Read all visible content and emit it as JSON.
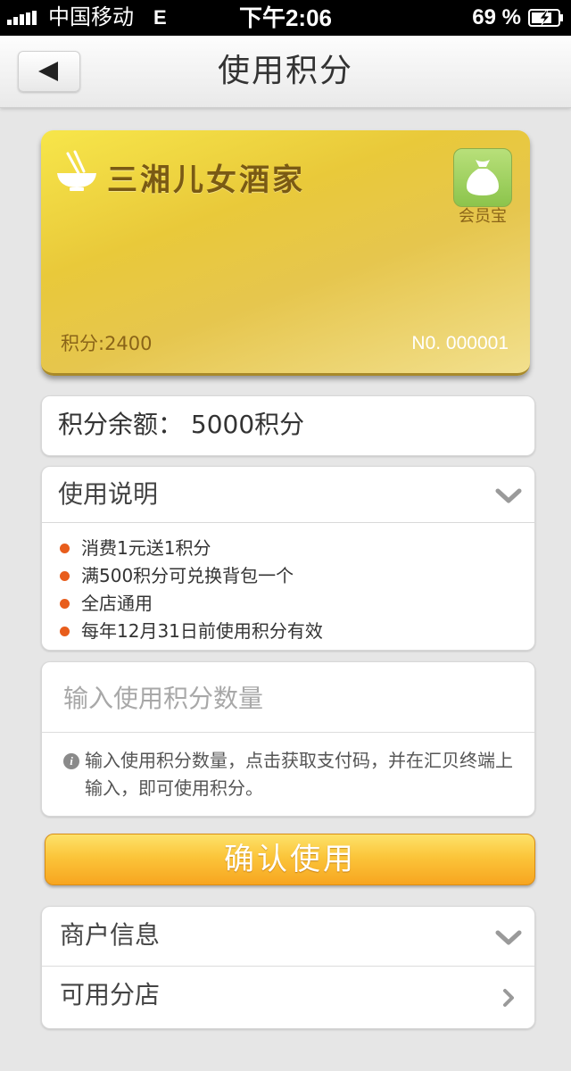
{
  "status_bar": {
    "carrier": "中国移动",
    "network": "E",
    "time": "下午2:06",
    "battery": "69 %",
    "icons": [
      "signal-icon",
      "battery-charging-icon"
    ]
  },
  "nav": {
    "title": "使用积分",
    "back_icon": "back-arrow-icon"
  },
  "card": {
    "store_name": "三湘儿女酒家",
    "brand_label": "会员宝",
    "points_label": "积分:2400",
    "card_no": "N0. 000001",
    "icons": [
      "rice-bowl-icon",
      "money-bag-icon"
    ],
    "colors": {
      "gold": "#e9c93a",
      "text": "#7a5a14"
    }
  },
  "balance": {
    "text": "积分余额： 5000积分"
  },
  "instructions": {
    "title": "使用说明",
    "items": [
      "消费1元送1积分",
      "满500积分可兑换背包一个",
      "全店通用",
      "每年12月31日前使用积分有效"
    ],
    "bullet_color": "#e85d1c"
  },
  "points_input": {
    "value": "",
    "placeholder": "输入使用积分数量",
    "hint": "输入使用积分数量，点击获取支付码，并在汇贝终端上输入，即可使用积分。"
  },
  "confirm_button": {
    "label": "确认使用",
    "color": "#fbc53a"
  },
  "merchant": {
    "info_label": "商户信息",
    "branches_label": "可用分店"
  }
}
